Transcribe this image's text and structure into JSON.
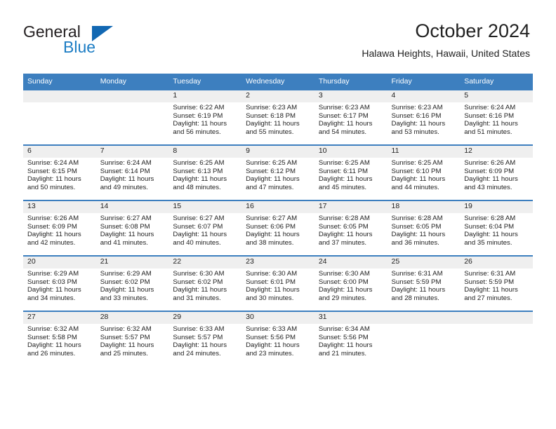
{
  "brand": {
    "name_dark": "General",
    "name_blue": "Blue",
    "color_blue": "#1268b3",
    "color_dark": "#231f20"
  },
  "header": {
    "title": "October 2024",
    "subtitle": "Halawa Heights, Hawaii, United States",
    "header_bg": "#3d7fbf",
    "daynum_bg": "#efefef"
  },
  "weekdays": [
    "Sunday",
    "Monday",
    "Tuesday",
    "Wednesday",
    "Thursday",
    "Friday",
    "Saturday"
  ],
  "weeks": [
    [
      {
        "day": "",
        "sunrise": "",
        "sunset": "",
        "daylight_line1": "",
        "daylight_line2": ""
      },
      {
        "day": "",
        "sunrise": "",
        "sunset": "",
        "daylight_line1": "",
        "daylight_line2": ""
      },
      {
        "day": "1",
        "sunrise": "Sunrise: 6:22 AM",
        "sunset": "Sunset: 6:19 PM",
        "daylight_line1": "Daylight: 11 hours",
        "daylight_line2": "and 56 minutes."
      },
      {
        "day": "2",
        "sunrise": "Sunrise: 6:23 AM",
        "sunset": "Sunset: 6:18 PM",
        "daylight_line1": "Daylight: 11 hours",
        "daylight_line2": "and 55 minutes."
      },
      {
        "day": "3",
        "sunrise": "Sunrise: 6:23 AM",
        "sunset": "Sunset: 6:17 PM",
        "daylight_line1": "Daylight: 11 hours",
        "daylight_line2": "and 54 minutes."
      },
      {
        "day": "4",
        "sunrise": "Sunrise: 6:23 AM",
        "sunset": "Sunset: 6:16 PM",
        "daylight_line1": "Daylight: 11 hours",
        "daylight_line2": "and 53 minutes."
      },
      {
        "day": "5",
        "sunrise": "Sunrise: 6:24 AM",
        "sunset": "Sunset: 6:16 PM",
        "daylight_line1": "Daylight: 11 hours",
        "daylight_line2": "and 51 minutes."
      }
    ],
    [
      {
        "day": "6",
        "sunrise": "Sunrise: 6:24 AM",
        "sunset": "Sunset: 6:15 PM",
        "daylight_line1": "Daylight: 11 hours",
        "daylight_line2": "and 50 minutes."
      },
      {
        "day": "7",
        "sunrise": "Sunrise: 6:24 AM",
        "sunset": "Sunset: 6:14 PM",
        "daylight_line1": "Daylight: 11 hours",
        "daylight_line2": "and 49 minutes."
      },
      {
        "day": "8",
        "sunrise": "Sunrise: 6:25 AM",
        "sunset": "Sunset: 6:13 PM",
        "daylight_line1": "Daylight: 11 hours",
        "daylight_line2": "and 48 minutes."
      },
      {
        "day": "9",
        "sunrise": "Sunrise: 6:25 AM",
        "sunset": "Sunset: 6:12 PM",
        "daylight_line1": "Daylight: 11 hours",
        "daylight_line2": "and 47 minutes."
      },
      {
        "day": "10",
        "sunrise": "Sunrise: 6:25 AM",
        "sunset": "Sunset: 6:11 PM",
        "daylight_line1": "Daylight: 11 hours",
        "daylight_line2": "and 45 minutes."
      },
      {
        "day": "11",
        "sunrise": "Sunrise: 6:25 AM",
        "sunset": "Sunset: 6:10 PM",
        "daylight_line1": "Daylight: 11 hours",
        "daylight_line2": "and 44 minutes."
      },
      {
        "day": "12",
        "sunrise": "Sunrise: 6:26 AM",
        "sunset": "Sunset: 6:09 PM",
        "daylight_line1": "Daylight: 11 hours",
        "daylight_line2": "and 43 minutes."
      }
    ],
    [
      {
        "day": "13",
        "sunrise": "Sunrise: 6:26 AM",
        "sunset": "Sunset: 6:09 PM",
        "daylight_line1": "Daylight: 11 hours",
        "daylight_line2": "and 42 minutes."
      },
      {
        "day": "14",
        "sunrise": "Sunrise: 6:27 AM",
        "sunset": "Sunset: 6:08 PM",
        "daylight_line1": "Daylight: 11 hours",
        "daylight_line2": "and 41 minutes."
      },
      {
        "day": "15",
        "sunrise": "Sunrise: 6:27 AM",
        "sunset": "Sunset: 6:07 PM",
        "daylight_line1": "Daylight: 11 hours",
        "daylight_line2": "and 40 minutes."
      },
      {
        "day": "16",
        "sunrise": "Sunrise: 6:27 AM",
        "sunset": "Sunset: 6:06 PM",
        "daylight_line1": "Daylight: 11 hours",
        "daylight_line2": "and 38 minutes."
      },
      {
        "day": "17",
        "sunrise": "Sunrise: 6:28 AM",
        "sunset": "Sunset: 6:05 PM",
        "daylight_line1": "Daylight: 11 hours",
        "daylight_line2": "and 37 minutes."
      },
      {
        "day": "18",
        "sunrise": "Sunrise: 6:28 AM",
        "sunset": "Sunset: 6:05 PM",
        "daylight_line1": "Daylight: 11 hours",
        "daylight_line2": "and 36 minutes."
      },
      {
        "day": "19",
        "sunrise": "Sunrise: 6:28 AM",
        "sunset": "Sunset: 6:04 PM",
        "daylight_line1": "Daylight: 11 hours",
        "daylight_line2": "and 35 minutes."
      }
    ],
    [
      {
        "day": "20",
        "sunrise": "Sunrise: 6:29 AM",
        "sunset": "Sunset: 6:03 PM",
        "daylight_line1": "Daylight: 11 hours",
        "daylight_line2": "and 34 minutes."
      },
      {
        "day": "21",
        "sunrise": "Sunrise: 6:29 AM",
        "sunset": "Sunset: 6:02 PM",
        "daylight_line1": "Daylight: 11 hours",
        "daylight_line2": "and 33 minutes."
      },
      {
        "day": "22",
        "sunrise": "Sunrise: 6:30 AM",
        "sunset": "Sunset: 6:02 PM",
        "daylight_line1": "Daylight: 11 hours",
        "daylight_line2": "and 31 minutes."
      },
      {
        "day": "23",
        "sunrise": "Sunrise: 6:30 AM",
        "sunset": "Sunset: 6:01 PM",
        "daylight_line1": "Daylight: 11 hours",
        "daylight_line2": "and 30 minutes."
      },
      {
        "day": "24",
        "sunrise": "Sunrise: 6:30 AM",
        "sunset": "Sunset: 6:00 PM",
        "daylight_line1": "Daylight: 11 hours",
        "daylight_line2": "and 29 minutes."
      },
      {
        "day": "25",
        "sunrise": "Sunrise: 6:31 AM",
        "sunset": "Sunset: 5:59 PM",
        "daylight_line1": "Daylight: 11 hours",
        "daylight_line2": "and 28 minutes."
      },
      {
        "day": "26",
        "sunrise": "Sunrise: 6:31 AM",
        "sunset": "Sunset: 5:59 PM",
        "daylight_line1": "Daylight: 11 hours",
        "daylight_line2": "and 27 minutes."
      }
    ],
    [
      {
        "day": "27",
        "sunrise": "Sunrise: 6:32 AM",
        "sunset": "Sunset: 5:58 PM",
        "daylight_line1": "Daylight: 11 hours",
        "daylight_line2": "and 26 minutes."
      },
      {
        "day": "28",
        "sunrise": "Sunrise: 6:32 AM",
        "sunset": "Sunset: 5:57 PM",
        "daylight_line1": "Daylight: 11 hours",
        "daylight_line2": "and 25 minutes."
      },
      {
        "day": "29",
        "sunrise": "Sunrise: 6:33 AM",
        "sunset": "Sunset: 5:57 PM",
        "daylight_line1": "Daylight: 11 hours",
        "daylight_line2": "and 24 minutes."
      },
      {
        "day": "30",
        "sunrise": "Sunrise: 6:33 AM",
        "sunset": "Sunset: 5:56 PM",
        "daylight_line1": "Daylight: 11 hours",
        "daylight_line2": "and 23 minutes."
      },
      {
        "day": "31",
        "sunrise": "Sunrise: 6:34 AM",
        "sunset": "Sunset: 5:56 PM",
        "daylight_line1": "Daylight: 11 hours",
        "daylight_line2": "and 21 minutes."
      },
      {
        "day": "",
        "sunrise": "",
        "sunset": "",
        "daylight_line1": "",
        "daylight_line2": ""
      },
      {
        "day": "",
        "sunrise": "",
        "sunset": "",
        "daylight_line1": "",
        "daylight_line2": ""
      }
    ]
  ]
}
